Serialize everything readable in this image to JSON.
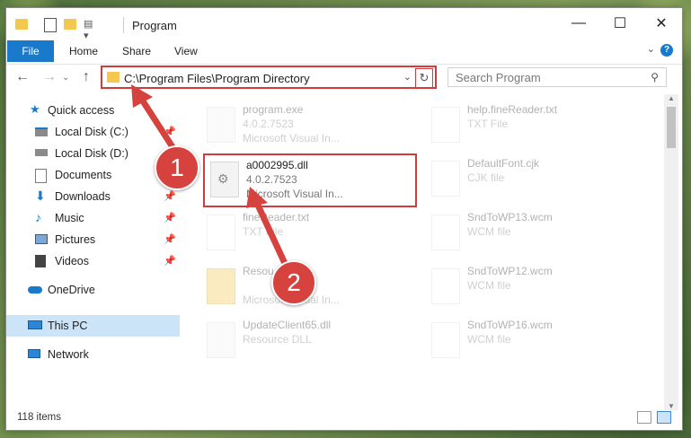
{
  "window": {
    "title": "Program"
  },
  "ribbon": {
    "tabs": [
      "File",
      "Home",
      "Share",
      "View"
    ],
    "help": "?"
  },
  "address": {
    "path": "C:\\Program Files\\Program Directory"
  },
  "search": {
    "placeholder": "Search Program"
  },
  "sidebar": {
    "items": [
      {
        "label": "Quick access"
      },
      {
        "label": "Local Disk (C:)"
      },
      {
        "label": "Local Disk (D:)"
      },
      {
        "label": "Documents"
      },
      {
        "label": "Downloads"
      },
      {
        "label": "Music"
      },
      {
        "label": "Pictures"
      },
      {
        "label": "Videos"
      },
      {
        "label": "OneDrive"
      },
      {
        "label": "This PC"
      },
      {
        "label": "Network"
      }
    ]
  },
  "files": [
    {
      "name": "program.exe",
      "line2": "4.0.2.7523",
      "line3": "Microsoft Visual In..."
    },
    {
      "name": "help.fineReader.txt",
      "line2": "TXT File",
      "line3": ""
    },
    {
      "name": "a0002995.dll",
      "line2": "4.0.2.7523",
      "line3": "Microsoft Visual In..."
    },
    {
      "name": "DefaultFont.cjk",
      "line2": "CJK file",
      "line3": ""
    },
    {
      "name": "fineReader.txt",
      "line2": "TXT File",
      "line3": ""
    },
    {
      "name": "SndToWP13.wcm",
      "line2": "WCM file",
      "line3": ""
    },
    {
      "name": "Resou...",
      "line2": "",
      "line3": "Microsoft Visual In..."
    },
    {
      "name": "SndToWP12.wcm",
      "line2": "WCM file",
      "line3": ""
    },
    {
      "name": "UpdateClient65.dll",
      "line2": "Resource DLL",
      "line3": ""
    },
    {
      "name": "SndToWP16.wcm",
      "line2": "WCM file",
      "line3": ""
    }
  ],
  "status": {
    "count": "118 items"
  },
  "callouts": [
    "1",
    "2"
  ],
  "colors": {
    "accent": "#1979ca",
    "highlight": "#d23b3b"
  }
}
